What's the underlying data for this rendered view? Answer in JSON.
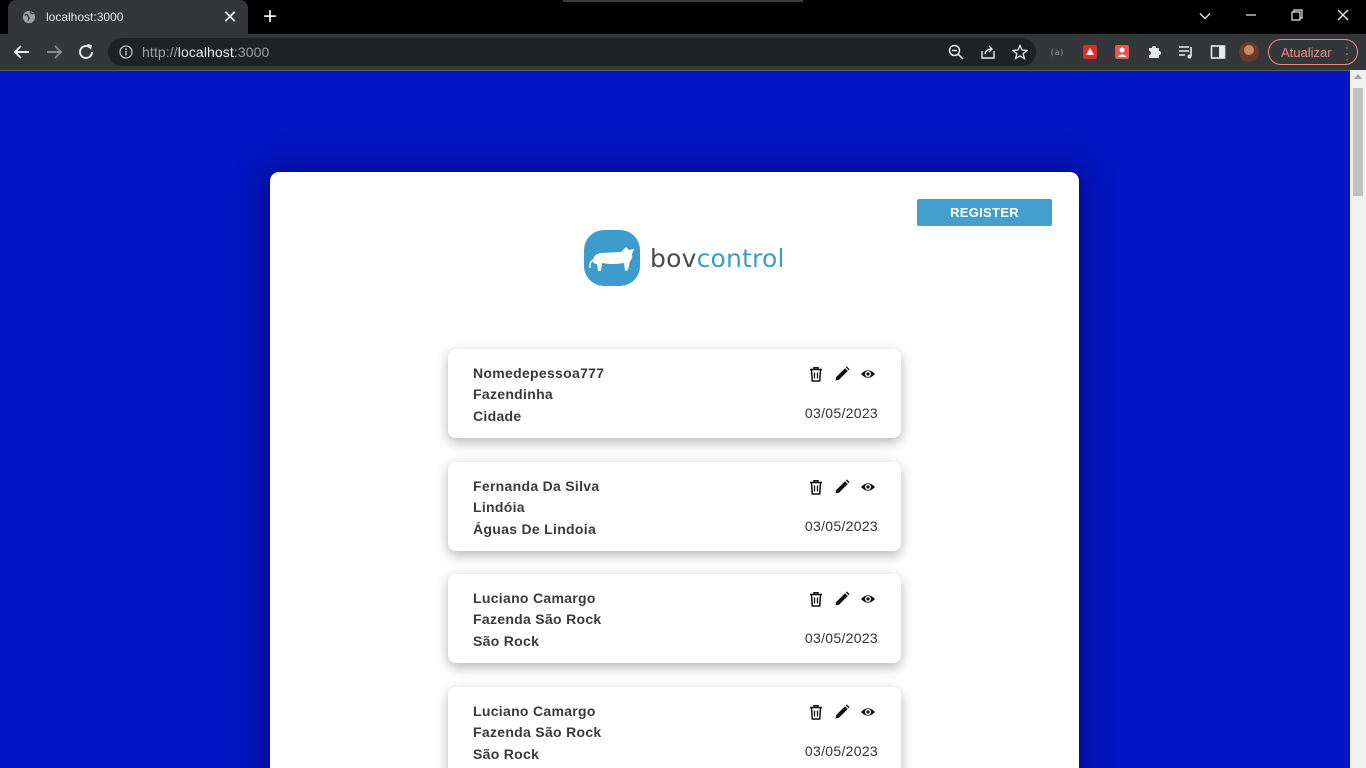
{
  "browser": {
    "tab_title": "localhost:3000",
    "tab_close": "✕",
    "new_tab": "+",
    "url_scheme": "http://",
    "url_host": "localhost",
    "url_port": ":3000",
    "extension_label": "(a)",
    "update_label": "Atualizar"
  },
  "page": {
    "register_label": "REGISTER",
    "logo": {
      "bov": "bov",
      "control": "control"
    },
    "records": [
      {
        "name": "Nomedepessoa777",
        "farm": "Fazendinha",
        "city": "Cidade",
        "date": "03/05/2023"
      },
      {
        "name": "Fernanda Da Silva",
        "farm": "Lindóia",
        "city": "Águas De Lindoia",
        "date": "03/05/2023"
      },
      {
        "name": "Luciano Camargo",
        "farm": "Fazenda São Rock",
        "city": "São Rock",
        "date": "03/05/2023"
      },
      {
        "name": "Luciano Camargo",
        "farm": "Fazenda São Rock",
        "city": "São Rock",
        "date": "03/05/2023"
      }
    ]
  },
  "colors": {
    "background": "#0415c3",
    "panel": "#ffffff",
    "accent": "#449fce",
    "logo_text_dark": "#4c4c4c",
    "logo_text_brand": "#3d9ccb"
  },
  "icons": {
    "delete": "trash-icon",
    "edit": "pencil-icon",
    "view": "eye-icon"
  }
}
